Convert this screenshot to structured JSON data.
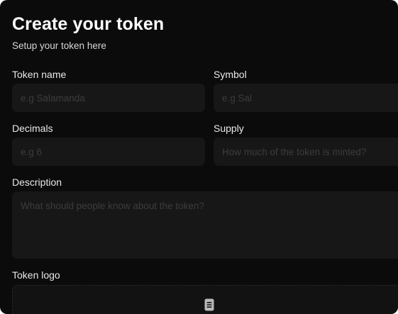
{
  "form": {
    "title": "Create your token",
    "subtitle": "Setup your token here",
    "token_name": {
      "label": "Token name",
      "placeholder": "e.g Salamanda"
    },
    "symbol": {
      "label": "Symbol",
      "placeholder": "e.g Sal"
    },
    "decimals": {
      "label": "Decimals",
      "placeholder": "e.g 6"
    },
    "supply": {
      "label": "Supply",
      "placeholder": "How much of the token is minted?"
    },
    "description": {
      "label": "Description",
      "placeholder": "What should people know about the token?"
    },
    "logo": {
      "label": "Token logo",
      "icon": "document-icon"
    }
  },
  "colors": {
    "background": "#0b0b0b",
    "field_background": "#171717",
    "placeholder": "#3c3c3c",
    "text": "#ffffff"
  }
}
